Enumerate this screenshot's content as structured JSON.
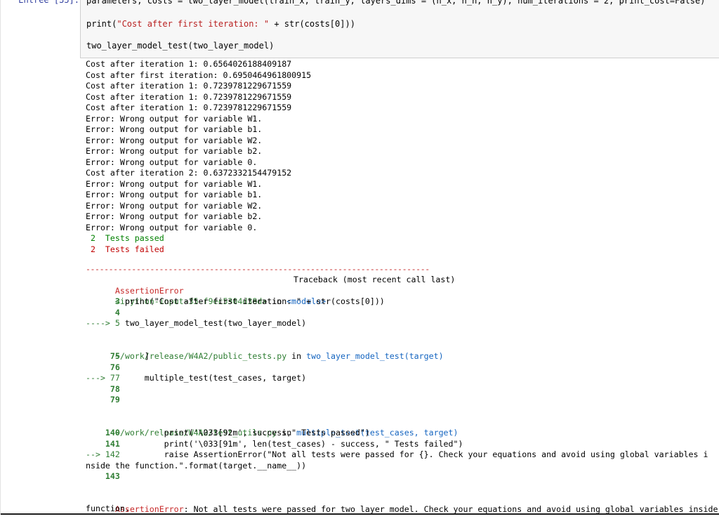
{
  "cell": {
    "prompt": "Entrée [35]:",
    "code_lines": [
      "parameters, costs = two_layer_model(train_x, train_y, layers_dims = (n_x, n_h, n_y), num_iterations = 2, print_cost=False)",
      "print(\"Cost after first iteration: \" + str(costs[0]))",
      "two_layer_model_test(two_layer_model)"
    ]
  },
  "output": {
    "stdout_lines": [
      "Cost after iteration 1: 0.6564026188409187",
      "Cost after first iteration: 0.6950464961800915",
      "Cost after iteration 1: 0.7239781229671559",
      "Cost after iteration 1: 0.7239781229671559",
      "Cost after iteration 1: 0.7239781229671559",
      "Error: Wrong output for variable W1.",
      "Error: Wrong output for variable b1.",
      "Error: Wrong output for variable W2.",
      "Error: Wrong output for variable b2.",
      "Error: Wrong output for variable 0.",
      "Cost after iteration 2: 0.6372332154479152",
      "Error: Wrong output for variable W1.",
      "Error: Wrong output for variable b1.",
      "Error: Wrong output for variable W2.",
      "Error: Wrong output for variable b2.",
      "Error: Wrong output for variable 0."
    ],
    "tests_passed": " 2  Tests passed",
    "tests_failed": " 2  Tests failed",
    "traceback": {
      "separator": "---------------------------------------------------------------------------",
      "error_name": "AssertionError",
      "header_right": "Traceback (most recent call last)",
      "input_ref": "<ipython-input-35-f9ec5304d38d>",
      "in_word": " in ",
      "module": "<module>",
      "frame1": [
        {
          "num": "      3 ",
          "code": "print(\"Cost after first iteration: \" + str(costs[0]))"
        },
        {
          "num": "      4",
          "code": ""
        },
        {
          "num": "----> 5 ",
          "code": "two_layer_model_test(two_layer_model)"
        }
      ],
      "file2": "~/work/release/W4A2/public_tests.py",
      "func2": "two_layer_model_test(target)",
      "frame2": [
        {
          "num": "     75 ",
          "code": "    ]"
        },
        {
          "num": "     76",
          "code": ""
        },
        {
          "num": "---> 77 ",
          "code": "    multiple_test(test_cases, target)"
        },
        {
          "num": "     78",
          "code": ""
        },
        {
          "num": "     79",
          "code": ""
        }
      ],
      "file3": "~/work/release/W4A2/test_utils.py",
      "func3": "multiple_test(test_cases, target)",
      "frame3": [
        {
          "num": "    140 ",
          "code": "        print('\\033[92m', success,\" Tests passed\")"
        },
        {
          "num": "    141 ",
          "code": "        print('\\033[91m', len(test_cases) - success, \" Tests failed\")"
        },
        {
          "num": "--> 142 ",
          "code": "        raise AssertionError(\"Not all tests were passed for {}. Check your equations and avoid using global variables i"
        },
        {
          "num": "",
          "code": "nside the function.\".format(target.__name__))"
        },
        {
          "num": "    143",
          "code": ""
        }
      ],
      "final_error_name": "AssertionError",
      "final_message": ": Not all tests were passed for two_layer_model. Check your equations and avoid using global variables inside the",
      "final_message_cont": "function."
    }
  }
}
